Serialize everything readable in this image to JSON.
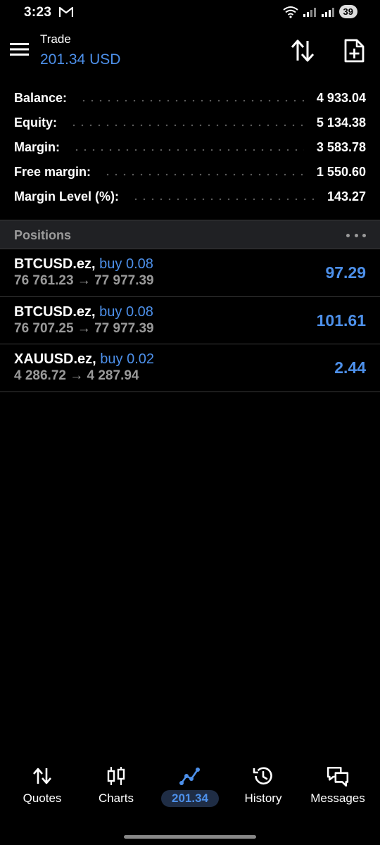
{
  "status_bar": {
    "time": "3:23",
    "battery": "39"
  },
  "app_bar": {
    "title": "Trade",
    "subtitle": "201.34 USD"
  },
  "summary": [
    {
      "label": "Balance:",
      "value": "4 933.04"
    },
    {
      "label": "Equity:",
      "value": "5 134.38"
    },
    {
      "label": "Margin:",
      "value": "3 583.78"
    },
    {
      "label": "Free margin:",
      "value": "1 550.60"
    },
    {
      "label": "Margin Level (%):",
      "value": "143.27"
    }
  ],
  "positions": {
    "title": "Positions",
    "items": [
      {
        "symbol": "BTCUSD.ez,",
        "side": "buy 0.08",
        "prices": "76 761.23 → 77 977.39",
        "profit": "97.29"
      },
      {
        "symbol": "BTCUSD.ez,",
        "side": "buy 0.08",
        "prices": "76 707.25 → 77 977.39",
        "profit": "101.61"
      },
      {
        "symbol": "XAUUSD.ez,",
        "side": "buy 0.02",
        "prices": "4 286.72 → 4 287.94",
        "profit": "2.44"
      }
    ]
  },
  "bottom_nav": [
    {
      "label": "Quotes",
      "icon": "quotes-arrows-icon"
    },
    {
      "label": "Charts",
      "icon": "candlestick-icon"
    },
    {
      "label": "201.34",
      "icon": "trade-line-icon",
      "active": true
    },
    {
      "label": "History",
      "icon": "history-clock-icon"
    },
    {
      "label": "Messages",
      "icon": "chat-bubbles-icon"
    }
  ],
  "colors": {
    "accent": "#4d90ea",
    "background": "#000000",
    "muted": "#9a9a9a",
    "header_bg": "#202124"
  }
}
